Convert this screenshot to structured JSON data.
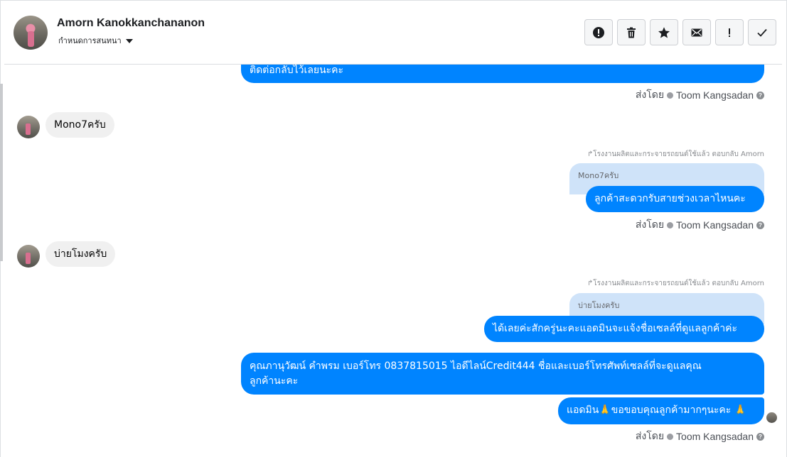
{
  "header": {
    "name": "Amorn Kanokkanchananon",
    "subtitle": "กำหนดการสนทนา"
  },
  "toolbar": {
    "icons": [
      "alert-circle-icon",
      "trash-icon",
      "star-icon",
      "mail-icon",
      "exclamation-icon",
      "check-icon"
    ]
  },
  "messages": {
    "m1_text": "ติดต่อกลับไว้เลยนะคะ",
    "sent_by_label": "ส่งโดย",
    "sender_name": "Toom Kangsadan",
    "in1": "Mono7ครับ",
    "reply_meta": "โรงงานผลิตและกระจายรถยนต์ใช้แล้ว ตอบกลับ Amorn",
    "quote1": "Mono7ครับ",
    "out2": "ลูกค้าสะดวกรับสายช่วงเวลาไหนคะ",
    "in2": "บ่ายโมงครับ",
    "quote2": "บ่ายโมงครับ",
    "out3": "ได้เลยค่ะสักครู่นะคะแอดมินจะแจ้งชื่อเซลล์ที่ดูแลลูกค้าค่ะ",
    "out4_line1": "คุณภานุวัฒน์ คำพรม       เบอร์โทร 0837815015  ไอดีไลน์Credit444  ชื่อและเบอร์โทรศัพท์เซลล์ที่จะดูแลคุณ",
    "out4_line2": "ลูกค้านะคะ",
    "out5": "แอดมิน🙏ขอขอบคุณลูกค้ามากๆนะคะ 🙏"
  }
}
